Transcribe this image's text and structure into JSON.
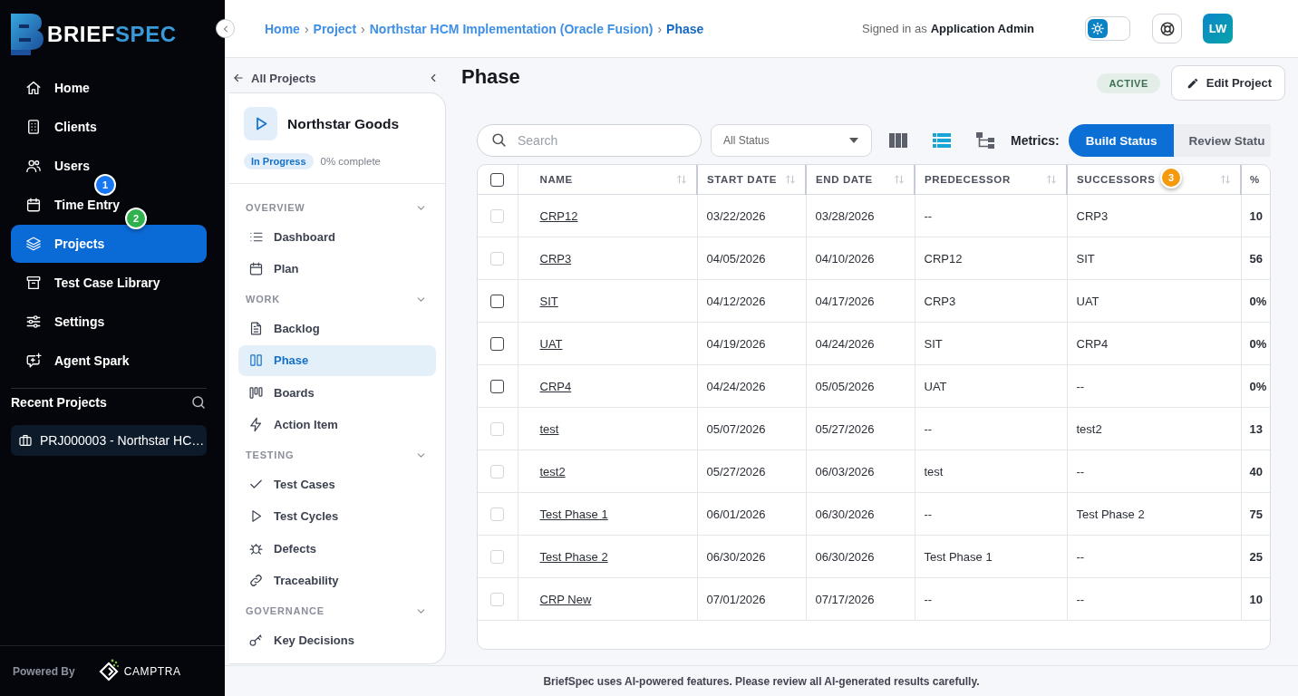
{
  "sidebar": {
    "logo": {
      "text_main": "BRIEF",
      "text_accent": "SPEC"
    },
    "nav_items": [
      {
        "label": "Home",
        "selected": false
      },
      {
        "label": "Clients",
        "selected": false
      },
      {
        "label": "Users",
        "selected": false
      },
      {
        "label": "Time Entry",
        "selected": false
      },
      {
        "label": "Projects",
        "selected": true
      },
      {
        "label": "Test Case Library",
        "selected": false
      },
      {
        "label": "Settings",
        "selected": false
      },
      {
        "label": "Agent Spark",
        "selected": false
      }
    ],
    "recent_projects": {
      "title": "Recent Projects",
      "items": [
        {
          "label": "PRJ000003 - Northstar HC…"
        }
      ]
    },
    "powered_by": "Powered By",
    "partner_logo_text": "CAMPTRA"
  },
  "header": {
    "breadcrumb": {
      "separator": "›",
      "items": [
        {
          "label": "Home",
          "current": false
        },
        {
          "label": "Project",
          "current": false
        },
        {
          "label": "Northstar HCM Implementation (Oracle Fusion)",
          "current": false
        },
        {
          "label": "Phase",
          "current": true
        }
      ]
    },
    "signed_in_prefix": "Signed in as",
    "signed_in_user": "Application Admin",
    "theme_toggle": {
      "dark_mode": false
    },
    "avatar": {
      "initials": "LW"
    }
  },
  "project_nav": {
    "back_label": "All Projects",
    "project": {
      "name": "Northstar Goods",
      "status": "In Progress",
      "progress_text": "0% complete"
    },
    "sections": [
      {
        "title": "OVERVIEW",
        "expanded": true,
        "items": [
          {
            "label": "Dashboard",
            "selected": false
          },
          {
            "label": "Plan",
            "selected": false
          }
        ]
      },
      {
        "title": "WORK",
        "expanded": true,
        "items": [
          {
            "label": "Backlog",
            "selected": false
          },
          {
            "label": "Phase",
            "selected": true
          },
          {
            "label": "Boards",
            "selected": false
          },
          {
            "label": "Action Item",
            "selected": false
          }
        ]
      },
      {
        "title": "TESTING",
        "expanded": true,
        "items": [
          {
            "label": "Test Cases",
            "selected": false
          },
          {
            "label": "Test Cycles",
            "selected": false
          },
          {
            "label": "Defects",
            "selected": false
          },
          {
            "label": "Traceability",
            "selected": false
          }
        ]
      },
      {
        "title": "GOVERNANCE",
        "expanded": true,
        "items": [
          {
            "label": "Key Decisions",
            "selected": false
          }
        ]
      }
    ]
  },
  "main": {
    "title": "Phase",
    "status_badge": "ACTIVE",
    "edit_button": "Edit Project",
    "toolbar": {
      "search": {
        "placeholder": "Search"
      },
      "status_filter": "All Status",
      "views": [
        {
          "kind": "columns",
          "selected": false
        },
        {
          "kind": "list",
          "selected": true
        },
        {
          "kind": "tree",
          "selected": false
        }
      ],
      "metrics_label": "Metrics:",
      "metrics": [
        {
          "label": "Build Status",
          "selected": true
        },
        {
          "label": "Review Statu",
          "selected": false
        }
      ]
    },
    "table": {
      "select_all": {
        "checked": false
      },
      "columns": [
        {
          "label": "NAME",
          "sortable": true
        },
        {
          "label": "START DATE",
          "sortable": true
        },
        {
          "label": "END DATE",
          "sortable": true
        },
        {
          "label": "PREDECESSOR",
          "sortable": true
        },
        {
          "label": "SUCCESSORS",
          "sortable": true
        },
        {
          "label": "%",
          "sortable": false
        }
      ],
      "rows": [
        {
          "name": "CRP12",
          "start_date": "03/22/2026",
          "end_date": "03/28/2026",
          "predecessor": "--",
          "successors": "CRP3",
          "percent": "10",
          "disabled": true,
          "checked": false
        },
        {
          "name": "CRP3",
          "start_date": "04/05/2026",
          "end_date": "04/10/2026",
          "predecessor": "CRP12",
          "successors": "SIT",
          "percent": "56",
          "disabled": true,
          "checked": false
        },
        {
          "name": "SIT",
          "start_date": "04/12/2026",
          "end_date": "04/17/2026",
          "predecessor": "CRP3",
          "successors": "UAT",
          "percent": "0%",
          "disabled": false,
          "checked": false
        },
        {
          "name": "UAT",
          "start_date": "04/19/2026",
          "end_date": "04/24/2026",
          "predecessor": "SIT",
          "successors": "CRP4",
          "percent": "0%",
          "disabled": false,
          "checked": false
        },
        {
          "name": "CRP4",
          "start_date": "04/24/2026",
          "end_date": "05/05/2026",
          "predecessor": "UAT",
          "successors": "--",
          "percent": "0%",
          "disabled": false,
          "checked": false
        },
        {
          "name": "test",
          "start_date": "05/07/2026",
          "end_date": "05/27/2026",
          "predecessor": "--",
          "successors": "test2",
          "percent": "13",
          "disabled": true,
          "checked": false
        },
        {
          "name": "test2",
          "start_date": "05/27/2026",
          "end_date": "06/03/2026",
          "predecessor": "test",
          "successors": "--",
          "percent": "40",
          "disabled": true,
          "checked": false
        },
        {
          "name": "Test Phase 1",
          "start_date": "06/01/2026",
          "end_date": "06/30/2026",
          "predecessor": "--",
          "successors": "Test Phase 2",
          "percent": "75",
          "disabled": true,
          "checked": false
        },
        {
          "name": "Test Phase 2",
          "start_date": "06/30/2026",
          "end_date": "06/30/2026",
          "predecessor": "Test Phase 1",
          "successors": "--",
          "percent": "25",
          "disabled": true,
          "checked": false
        },
        {
          "name": "CRP New",
          "start_date": "07/01/2026",
          "end_date": "07/17/2026",
          "predecessor": "--",
          "successors": "--",
          "percent": "10",
          "disabled": true,
          "checked": false
        }
      ]
    }
  },
  "footer": {
    "notice": "BriefSpec uses AI-powered features. Please review all AI-generated results carefully."
  },
  "markers": [
    {
      "label": "1",
      "color": "#1877f2"
    },
    {
      "label": "2",
      "color": "#2fb24c"
    },
    {
      "label": "3",
      "color": "#f59a0c"
    }
  ]
}
